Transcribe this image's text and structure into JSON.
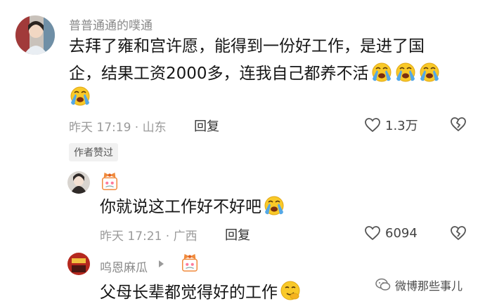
{
  "comment1": {
    "username": "普普通通的噗通",
    "text_line1": "去拜了雍和宫许愿，能得到一份好工作，是进了国",
    "text_line2": "企，结果工资2000多，连我自己都养不活",
    "meta": "昨天 17:19 · 山东",
    "reply_label": "回复",
    "likes": "1.3万",
    "author_liked_badge": "作者赞过",
    "emoji_count": 4
  },
  "reply1": {
    "text": "你就说这工作好不好吧",
    "meta": "昨天 17:21 · 广西",
    "reply_label": "回复",
    "likes": "6094"
  },
  "reply2": {
    "username": "呜恩麻瓜",
    "text": "父母长辈都觉得好的工作"
  },
  "watermark": {
    "text": "微博那些事儿"
  },
  "colors": {
    "text": "#161616",
    "meta": "#9a9a9a",
    "emoji_yellow": "#f9c928",
    "emoji_blue": "#54a8e6"
  }
}
